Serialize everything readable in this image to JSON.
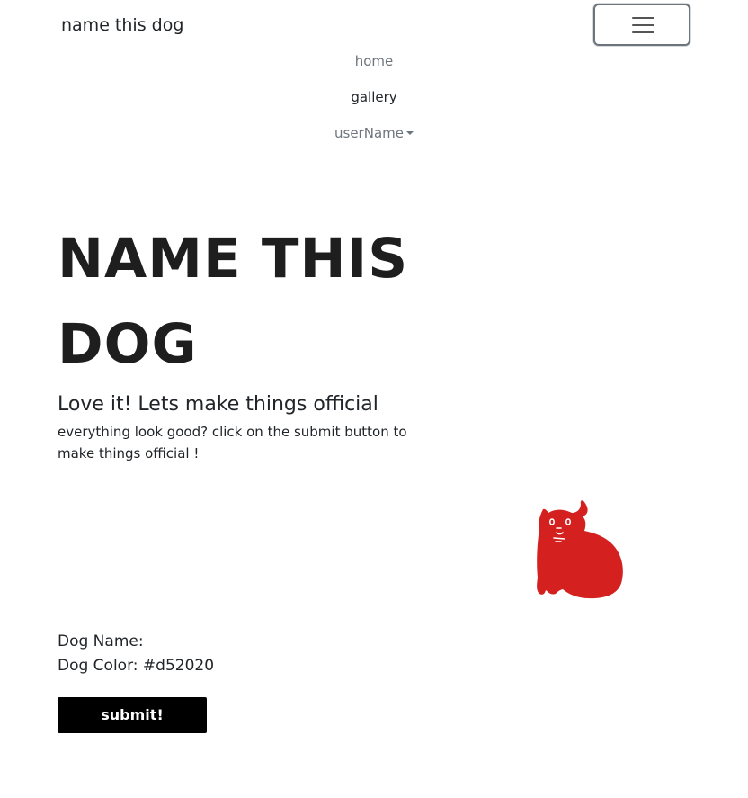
{
  "navbar": {
    "brand": "name this dog",
    "toggler_icon": "hamburger-menu-icon",
    "links": [
      {
        "label": "home"
      },
      {
        "label": "gallery"
      },
      {
        "label": "userName"
      }
    ],
    "dropdown_icon": "caret-down-icon"
  },
  "hero": {
    "title_line1": "NAME THIS",
    "title_line2": "DOG",
    "subtitle": "Love it! Lets make things official",
    "description": "everything look good? click on the submit button to make things official !"
  },
  "dog": {
    "icon": "dog-illustration",
    "color": "#d52020"
  },
  "details": {
    "name_label": "Dog Name:",
    "name_value": "",
    "color_label": "Dog Color:",
    "color_value": "#d52020"
  },
  "actions": {
    "submit_label": "submit!"
  }
}
